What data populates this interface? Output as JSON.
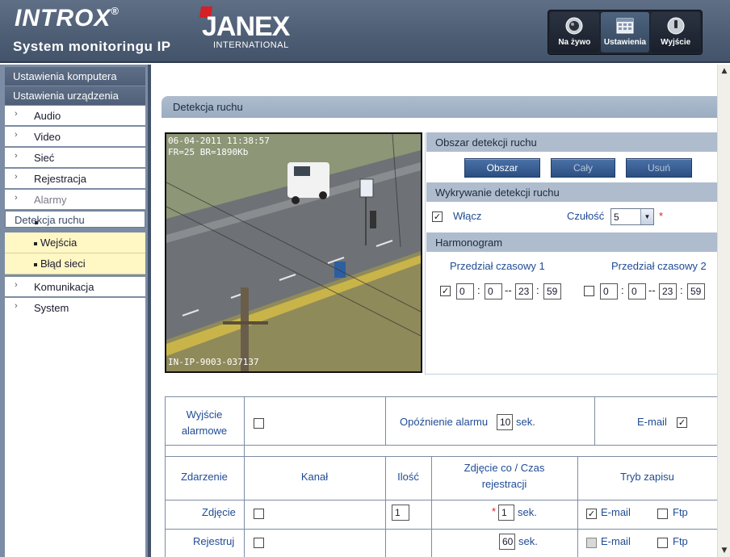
{
  "header": {
    "brand": "INTROX",
    "brand_reg": "®",
    "subtitle": "System monitoringu IP",
    "partner": "ANEX",
    "partner_letter": "J",
    "partner_sub": "INTERNATIONAL",
    "nav": [
      {
        "label": "Na żywo",
        "icon": "camera-icon"
      },
      {
        "label": "Ustawienia",
        "icon": "settings-grid-icon"
      },
      {
        "label": "Wyjście",
        "icon": "power-icon"
      }
    ]
  },
  "sidebar": {
    "section_computer": "Ustawienia komputera",
    "section_device": "Ustawienia urządzenia",
    "items": [
      "Audio",
      "Video",
      "Sieć",
      "Rejestracja",
      "Alarmy"
    ],
    "sub_items": [
      "Detekcja ruchu",
      "Wejścia",
      "Błąd sieci"
    ],
    "items_after": [
      "Komunikacja",
      "System"
    ]
  },
  "page": {
    "title": "Detekcja ruchu",
    "video_overlay_1": "06-04-2011 11:38:57",
    "video_overlay_2": "FR=25 BR=1890Kb",
    "video_overlay_3": "IN-IP-9003-037137",
    "area": {
      "heading": "Obszar detekcji ruchu",
      "buttons": [
        "Obszar",
        "Cały",
        "Usuń"
      ]
    },
    "detect": {
      "heading": "Wykrywanie detekcji ruchu",
      "enable_label": "Włącz",
      "enabled": true,
      "sensitivity_label": "Czułość",
      "sensitivity_value": "5",
      "required_mark": "*"
    },
    "schedule": {
      "heading": "Harmonogram",
      "ranges": [
        {
          "label": "Przedział czasowy 1",
          "checked": true,
          "values": [
            "0",
            "0",
            "23",
            "59"
          ]
        },
        {
          "label": "Przedział czasowy 2",
          "checked": false,
          "values": [
            "0",
            "0",
            "23",
            "59"
          ]
        }
      ],
      "sep_colon": ":",
      "sep_dash": "--"
    }
  },
  "alarm_table": {
    "alarm_output_label_1": "Wyjście",
    "alarm_output_label_2": "alarmowe",
    "delay_label": "Opóźnienie alarmu",
    "delay_value": "10",
    "delay_unit": "sek.",
    "email_label": "E-mail",
    "email_checked": true,
    "headers": {
      "event": "Zdarzenie",
      "channel": "Kanał",
      "count": "Ilość",
      "interval_1": "Zdjęcie co / Czas",
      "interval_2": "rejestracji",
      "mode": "Tryb zapisu"
    },
    "rows": [
      {
        "event": "Zdjęcie",
        "count": "1",
        "star": "*",
        "interval": "1",
        "unit": "sek.",
        "email": "E-mail",
        "email_checked": true,
        "ftp": "Ftp"
      },
      {
        "event": "Rejestruj",
        "interval": "60",
        "unit": "sek.",
        "email": "E-mail",
        "email_checked": false,
        "ftp": "Ftp"
      }
    ]
  },
  "colors": {
    "header_bg": "#4d5d74",
    "sidebar_bg": "#7c8ca4",
    "submenu_bg": "#fff7c4",
    "accent_blue": "#1f4b94",
    "section_head": "#aebccd",
    "button_blue": "#2c4f82"
  }
}
